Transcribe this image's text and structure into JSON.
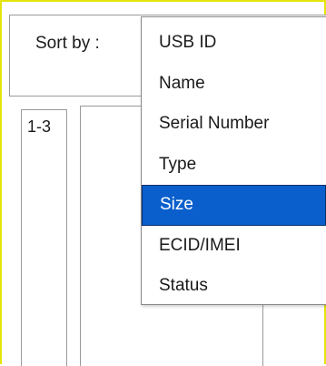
{
  "sort": {
    "label": "Sort by :",
    "selected": "Size",
    "options": [
      {
        "label": "USB ID"
      },
      {
        "label": "Name"
      },
      {
        "label": "Serial Number"
      },
      {
        "label": "Type"
      },
      {
        "label": "Size"
      },
      {
        "label": "ECID/IMEI"
      },
      {
        "label": "Status"
      }
    ]
  },
  "list": {
    "range": "1-3"
  },
  "colors": {
    "frame_border": "#e4e40c",
    "selection": "#0a5fcc",
    "panel_border": "#9a9a9a"
  }
}
